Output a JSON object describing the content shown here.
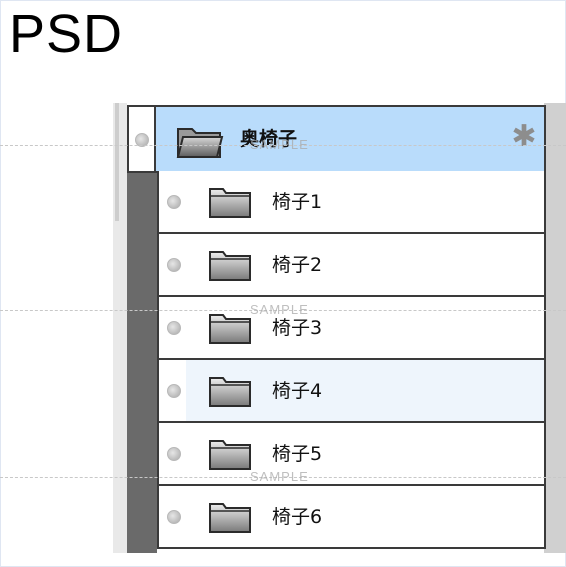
{
  "title": "PSD",
  "group": {
    "label": "奥椅子",
    "icon": "folder-open-icon",
    "settings_icon": "gear-icon"
  },
  "layers": [
    {
      "label": "椅子1",
      "icon": "folder-icon"
    },
    {
      "label": "椅子2",
      "icon": "folder-icon"
    },
    {
      "label": "椅子3",
      "icon": "folder-icon"
    },
    {
      "label": "椅子4",
      "icon": "folder-icon",
      "highlighted": true
    },
    {
      "label": "椅子5",
      "icon": "folder-icon"
    },
    {
      "label": "椅子6",
      "icon": "folder-icon"
    }
  ],
  "watermark_text": "SAMPLE",
  "colors": {
    "selected_row": "#b9dcfb",
    "hover_row": "#eef5fc",
    "gutter": "#6a6a6a",
    "border": "#3a3a3a"
  }
}
